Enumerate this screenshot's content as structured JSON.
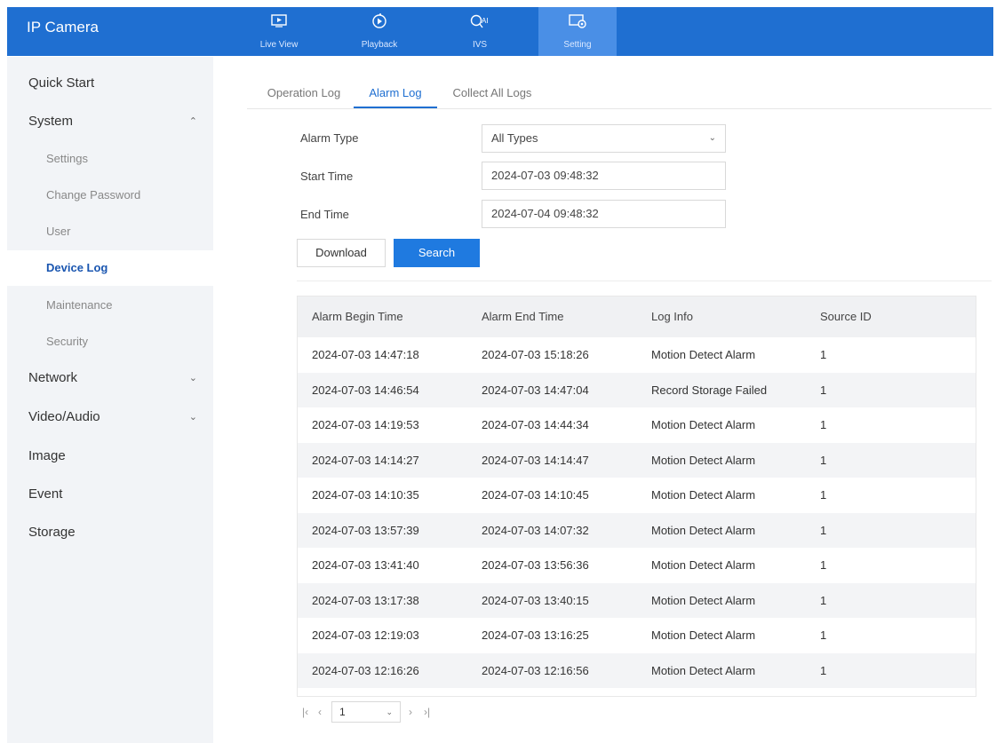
{
  "app": {
    "title": "IP Camera"
  },
  "nav": {
    "tabs": [
      {
        "label": "Live View",
        "icon": "live-view-icon"
      },
      {
        "label": "Playback",
        "icon": "playback-icon"
      },
      {
        "label": "IVS",
        "icon": "ivs-icon"
      },
      {
        "label": "Setting",
        "icon": "setting-icon",
        "active": true
      }
    ]
  },
  "sidebar": {
    "quick_start": "Quick Start",
    "system": "System",
    "settings": "Settings",
    "change_password": "Change Password",
    "user": "User",
    "device_log": "Device Log",
    "maintenance": "Maintenance",
    "security": "Security",
    "network": "Network",
    "video_audio": "Video/Audio",
    "image": "Image",
    "event": "Event",
    "storage": "Storage"
  },
  "subtabs": {
    "operation_log": "Operation Log",
    "alarm_log": "Alarm Log",
    "collect_all_logs": "Collect All Logs"
  },
  "form": {
    "alarm_type_label": "Alarm Type",
    "alarm_type_value": "All Types",
    "start_time_label": "Start Time",
    "start_time_value": "2024-07-03 09:48:32",
    "end_time_label": "End Time",
    "end_time_value": "2024-07-04 09:48:32",
    "download": "Download",
    "search": "Search"
  },
  "table": {
    "headers": {
      "begin": "Alarm Begin Time",
      "end": "Alarm End Time",
      "info": "Log Info",
      "source": "Source ID"
    },
    "rows": [
      {
        "begin": "2024-07-03 14:47:18",
        "end": "2024-07-03 15:18:26",
        "info": "Motion Detect Alarm",
        "source": "1"
      },
      {
        "begin": "2024-07-03 14:46:54",
        "end": "2024-07-03 14:47:04",
        "info": "Record Storage Failed",
        "source": "1"
      },
      {
        "begin": "2024-07-03 14:19:53",
        "end": "2024-07-03 14:44:34",
        "info": "Motion Detect Alarm",
        "source": "1"
      },
      {
        "begin": "2024-07-03 14:14:27",
        "end": "2024-07-03 14:14:47",
        "info": "Motion Detect Alarm",
        "source": "1"
      },
      {
        "begin": "2024-07-03 14:10:35",
        "end": "2024-07-03 14:10:45",
        "info": "Motion Detect Alarm",
        "source": "1"
      },
      {
        "begin": "2024-07-03 13:57:39",
        "end": "2024-07-03 14:07:32",
        "info": "Motion Detect Alarm",
        "source": "1"
      },
      {
        "begin": "2024-07-03 13:41:40",
        "end": "2024-07-03 13:56:36",
        "info": "Motion Detect Alarm",
        "source": "1"
      },
      {
        "begin": "2024-07-03 13:17:38",
        "end": "2024-07-03 13:40:15",
        "info": "Motion Detect Alarm",
        "source": "1"
      },
      {
        "begin": "2024-07-03 12:19:03",
        "end": "2024-07-03 13:16:25",
        "info": "Motion Detect Alarm",
        "source": "1"
      },
      {
        "begin": "2024-07-03 12:16:26",
        "end": "2024-07-03 12:16:56",
        "info": "Motion Detect Alarm",
        "source": "1"
      }
    ]
  },
  "pagination": {
    "page": "1"
  },
  "colors": {
    "brand": "#1f6fd1",
    "active_tab": "#4a8fe6",
    "search_button": "#1f7ae0",
    "selected_sidebar_text": "#1a56b0"
  }
}
